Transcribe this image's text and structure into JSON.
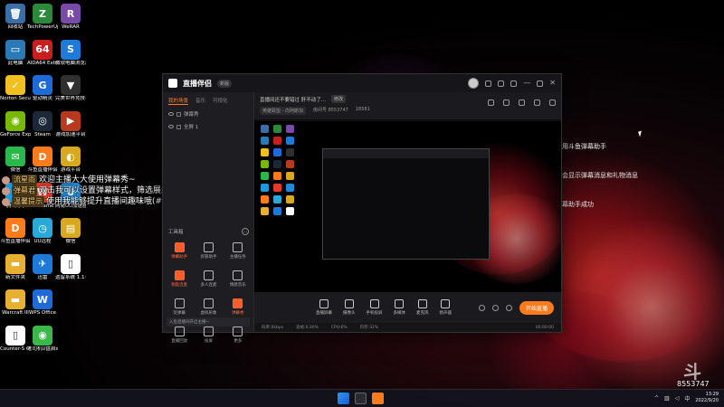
{
  "desktop": {
    "icons": [
      {
        "label": "回收站",
        "color": "#3b6ea8",
        "glyph": "🗑"
      },
      {
        "label": "TechPowerUp GPU-Z",
        "color": "#2a8a3a",
        "glyph": "Z"
      },
      {
        "label": "WeRAR",
        "color": "#7a4aa8",
        "glyph": "R"
      },
      {
        "label": "此电脑",
        "color": "#2a7ab8",
        "glyph": "▭"
      },
      {
        "label": "AIDA64 Extreme",
        "color": "#c81e1e",
        "glyph": "64"
      },
      {
        "label": "微软电脑浏览器",
        "color": "#1e7ad8",
        "glyph": "S"
      },
      {
        "label": "Norton Security",
        "color": "#f0c020",
        "glyph": "✓"
      },
      {
        "label": "驱动精灵",
        "color": "#1e6ad8",
        "glyph": "G"
      },
      {
        "label": "完美世界竞技平台",
        "color": "#303030",
        "glyph": "▼"
      },
      {
        "label": "GeForce Experience",
        "color": "#76b900",
        "glyph": "◉"
      },
      {
        "label": "Steam",
        "color": "#1b2838",
        "glyph": "◎"
      },
      {
        "label": "游戏加速平台",
        "color": "#b83a1e",
        "glyph": "▶"
      },
      {
        "label": "微信",
        "color": "#2ab84a",
        "glyph": "✉"
      },
      {
        "label": "斗鱼直播伴侣",
        "color": "#ff7a1a",
        "glyph": "D"
      },
      {
        "label": "游戏平台",
        "color": "#d8a81e",
        "glyph": "◐"
      },
      {
        "label": "腾讯QQ",
        "color": "#1e9ad8",
        "glyph": "Q"
      },
      {
        "label": "WeGame",
        "color": "#e83a2a",
        "glyph": "W"
      },
      {
        "label": "网易UU加速器",
        "color": "#1e8ad8",
        "glyph": "U"
      },
      {
        "label": "斗鱼直播伴侣",
        "color": "#ff7a1a",
        "glyph": "D"
      },
      {
        "label": "UU远程",
        "color": "#2aa8d8",
        "glyph": "◷"
      },
      {
        "label": "微信",
        "color": "#d8a81e",
        "glyph": "▤"
      },
      {
        "label": "新文件夹",
        "color": "#e8b030",
        "glyph": "▬"
      },
      {
        "label": "迅雷",
        "color": "#1e7ad8",
        "glyph": "✈"
      },
      {
        "label": "遗留系统 1.1~1.31",
        "color": "#ffffff",
        "glyph": "▯"
      },
      {
        "label": "Warcraft III",
        "color": "#e8b030",
        "glyph": "▬"
      },
      {
        "label": "WPS Office",
        "color": "#1e6ad8",
        "glyph": "W"
      },
      {
        "label": "Counter-S Global Off",
        "color": "#ffffff",
        "glyph": "▯"
      },
      {
        "label": "老司机U盘启动制作工具",
        "color": "#3ab84a",
        "glyph": "◉"
      }
    ]
  },
  "chat": [
    {
      "name": "流星雨",
      "text": "欢迎主播大大使用弹幕秀~"
    },
    {
      "name": "弹幕君",
      "text": "双击我可以设置弹幕样式，筛选展示哦~"
    },
    {
      "name": "温馨提示",
      "text": "使用我能够提升直播间趣味哦(#^.^#)"
    }
  ],
  "side_notes": [
    "欢迎使用斗鱼弹幕助手",
    "本区域会显示弹幕消息和礼物消息",
    "添加弹幕助手成功"
  ],
  "app": {
    "title": "直播伴侣",
    "version_badge": "新版",
    "tabs": [
      "我的场景",
      "音乐",
      "可视化"
    ],
    "scenes": [
      "弹幕秀",
      "全屏 1"
    ],
    "tools_header": "工具箱",
    "tools": [
      {
        "label": "弹幕助手",
        "hot": true
      },
      {
        "label": "房管助手",
        "hot": false
      },
      {
        "label": "主播任务",
        "hot": false
      },
      {
        "label": "钥匙连麦",
        "hot": true
      },
      {
        "label": "多人连麦",
        "hot": false
      },
      {
        "label": "情感音乐",
        "hot": false
      },
      {
        "label": "玩弹幕",
        "hot": false
      },
      {
        "label": "虚拟形象",
        "hot": false
      },
      {
        "label": "弹幕秀",
        "hot": true
      },
      {
        "label": "直播回放",
        "hot": false
      },
      {
        "label": "投屏",
        "hot": false
      },
      {
        "label": "更多",
        "hot": false
      }
    ],
    "notice": "入鱼直播间开启主播~",
    "room_title": "直播间还不要错过 肝不动了...",
    "room_title_button": "修改",
    "category": "英雄联盟 - 向阿斯加",
    "room_id": "房间号 8553747",
    "fans": "18581",
    "controls": [
      "直播屏幕",
      "摄像头",
      "手机投屏",
      "多媒体",
      "麦克风",
      "扬声器"
    ],
    "start_live": "开始直播",
    "status": [
      "码率:0kbps",
      "丢帧:0.00%",
      "CPU:6%",
      "内存:32%"
    ],
    "status_time": "00:00:00"
  },
  "taskbar": {
    "tray_lang": "中",
    "time": "13:29",
    "date": "2022/9/20"
  },
  "watermark": {
    "room_number": "8553747",
    "mark": "斗"
  }
}
